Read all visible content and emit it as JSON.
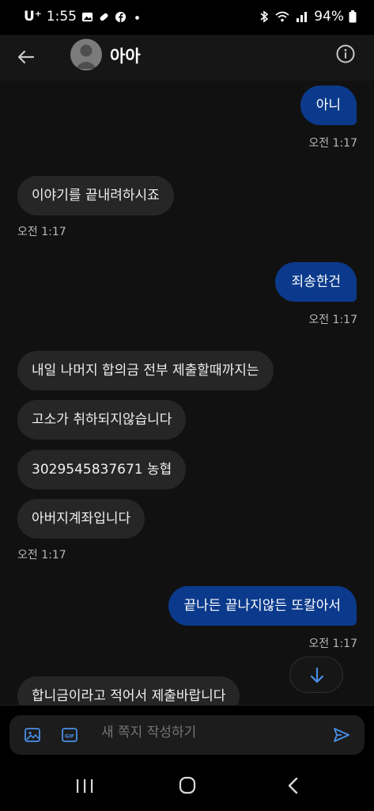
{
  "status_bar": {
    "carrier": "U⁺",
    "time": "1:55",
    "battery": "94%"
  },
  "header": {
    "title": "아아",
    "back_icon": "arrow-left-icon",
    "info_icon": "info-circle-icon"
  },
  "messages": [
    {
      "direction": "sent",
      "text": "아니",
      "time": "오전 1:17"
    },
    {
      "direction": "received",
      "text": "이야기를 끝내려하시죠",
      "time": "오전 1:17"
    },
    {
      "direction": "sent",
      "text": "죄송한건",
      "time": "오전 1:17"
    },
    {
      "direction": "received",
      "text": "내일 나머지 합의금 전부 제출할때까지는"
    },
    {
      "direction": "received",
      "text": "고소가 취하되지않습니다"
    },
    {
      "direction": "received",
      "text": "3029545837671 농협"
    },
    {
      "direction": "received",
      "text": "아버지계좌입니다",
      "time": "오전 1:17"
    },
    {
      "direction": "sent",
      "text": "끝나든 끝나지않든 또칼아서",
      "time": "오전 1:17"
    },
    {
      "direction": "received",
      "text": "합니금이라고 적어서 제출바랍니다"
    }
  ],
  "composer": {
    "placeholder": "새 쪽지 작성하기"
  },
  "colors": {
    "sent_bubble": "#0b3a8c",
    "received_bubble": "#262626",
    "accent": "#4a8fe7"
  }
}
